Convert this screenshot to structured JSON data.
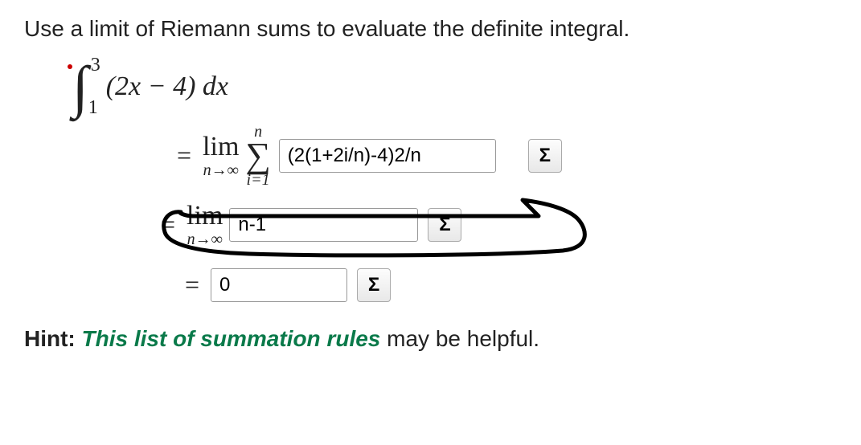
{
  "question": "Use a limit of Riemann sums to evaluate the definite integral.",
  "integral": {
    "upper": "3",
    "lower": "1",
    "integrand": "(2x − 4) dx"
  },
  "step1": {
    "equals": "=",
    "lim": "lim",
    "lim_sub": "n→∞",
    "sigma_top": "n",
    "sigma": "∑",
    "sigma_bot": "i=1",
    "input_value": "(2(1+2i/n)-4)2/n",
    "sigma_button": "Σ"
  },
  "step2": {
    "equals": "=",
    "lim": "lim",
    "lim_sub": "n→∞",
    "input_value": "n-1",
    "sigma_button": "Σ"
  },
  "step3": {
    "equals": "=",
    "input_value": "0",
    "sigma_button": "Σ"
  },
  "hint": {
    "label": "Hint: ",
    "link_text": "This list of summation rules",
    "rest": " may be helpful."
  }
}
